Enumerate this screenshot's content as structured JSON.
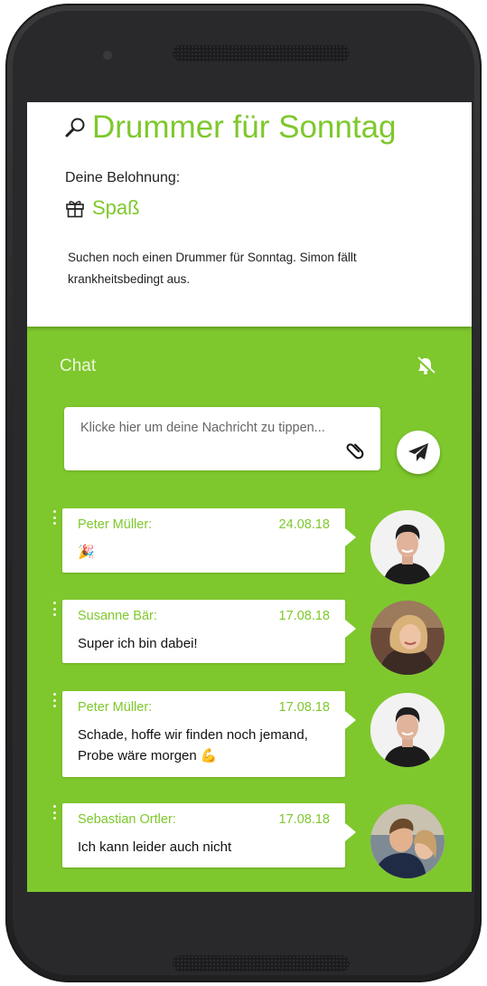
{
  "task": {
    "title": "Drummer für Sonntag",
    "reward_label": "Deine Belohnung:",
    "reward": "Spaß",
    "description": "Suchen noch einen Drummer für Sonntag. Simon fällt krankheitsbedingt aus."
  },
  "chat": {
    "label": "Chat",
    "input_placeholder": "Klicke hier um deine Nachricht zu tippen...",
    "messages": [
      {
        "sender": "Peter Müller:",
        "date": "24.08.18",
        "text": "🎉",
        "avatar": "peter"
      },
      {
        "sender": "Susanne Bär:",
        "date": "17.08.18",
        "text": "Super ich bin dabei!",
        "avatar": "susanne"
      },
      {
        "sender": "Peter Müller:",
        "date": "17.08.18",
        "text": "Schade, hoffe wir finden noch jemand, Probe wäre morgen 💪",
        "avatar": "peter"
      },
      {
        "sender": "Sebastian Ortler:",
        "date": "17.08.18",
        "text": "Ich kann leider auch nicht",
        "avatar": "sebastian"
      }
    ]
  },
  "colors": {
    "accent": "#7ec82d",
    "phone_body": "#29292b"
  }
}
